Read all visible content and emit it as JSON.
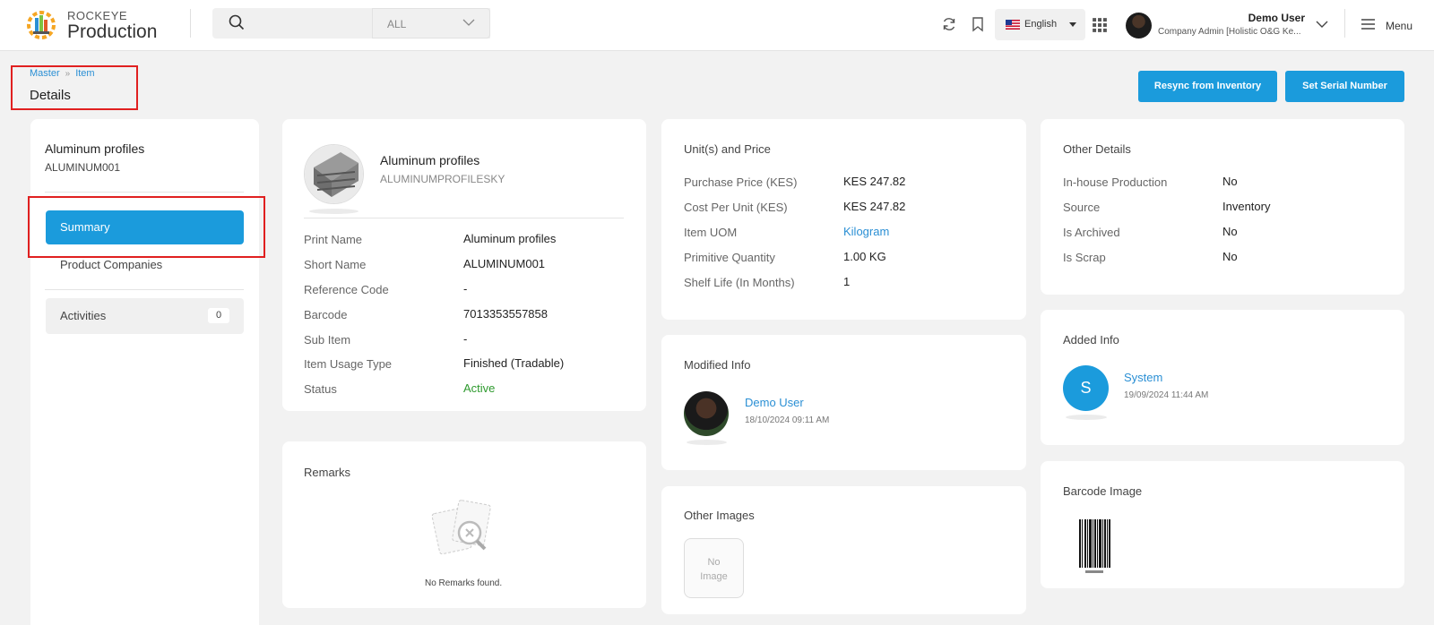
{
  "brand": {
    "top": "ROCKEYE",
    "main": "Production"
  },
  "search": {
    "placeholder": "",
    "filter_value": "ALL"
  },
  "language": {
    "label": "English"
  },
  "user": {
    "name": "Demo User",
    "role": "Company Admin [Holistic O&G Ke..."
  },
  "menu_label": "Menu",
  "breadcrumb": {
    "items": [
      "Master",
      "Item"
    ]
  },
  "page_title": "Details",
  "actions": {
    "resync": "Resync from Inventory",
    "serial": "Set Serial Number"
  },
  "left_panel": {
    "name": "Aluminum profiles",
    "code": "ALUMINUM001",
    "nav": {
      "summary": "Summary",
      "product_companies": "Product Companies",
      "activities": "Activities",
      "activities_count": "0"
    }
  },
  "item_card": {
    "name": "Aluminum profiles",
    "sku": "ALUMINUMPROFILESKY",
    "fields": [
      {
        "label": "Print Name",
        "value": "Aluminum profiles"
      },
      {
        "label": "Short Name",
        "value": "ALUMINUM001"
      },
      {
        "label": "Reference Code",
        "value": "-"
      },
      {
        "label": "Barcode",
        "value": "7013353557858"
      },
      {
        "label": "Sub Item",
        "value": "-"
      },
      {
        "label": "Item Usage Type",
        "value": "Finished (Tradable)"
      },
      {
        "label": "Status",
        "value": "Active"
      }
    ]
  },
  "remarks": {
    "title": "Remarks",
    "empty_text": "No Remarks found."
  },
  "units_price": {
    "title": "Unit(s) and Price",
    "fields": [
      {
        "label": "Purchase Price (KES)",
        "value": "KES 247.82"
      },
      {
        "label": "Cost Per Unit (KES)",
        "value": "KES 247.82"
      },
      {
        "label": "Item UOM",
        "value": "Kilogram"
      },
      {
        "label": "Primitive Quantity",
        "value": "1.00 KG"
      },
      {
        "label": "Shelf Life (In Months)",
        "value": "1"
      }
    ]
  },
  "modified_info": {
    "title": "Modified Info",
    "user": "Demo User",
    "timestamp": "18/10/2024 09:11 AM"
  },
  "other_images": {
    "title": "Other Images",
    "no_image_line1": "No",
    "no_image_line2": "Image"
  },
  "other_details": {
    "title": "Other Details",
    "fields": [
      {
        "label": "In-house Production",
        "value": "No"
      },
      {
        "label": "Source",
        "value": "Inventory"
      },
      {
        "label": "Is Archived",
        "value": "No"
      },
      {
        "label": "Is Scrap",
        "value": "No"
      }
    ]
  },
  "added_info": {
    "title": "Added Info",
    "initial": "S",
    "user": "System",
    "timestamp": "19/09/2024 11:44 AM"
  },
  "barcode_image": {
    "title": "Barcode Image"
  },
  "colors": {
    "accent": "#1b9bdc",
    "link": "#2a8fd4",
    "active": "#2e9a2e",
    "highlight": "#e02020"
  }
}
